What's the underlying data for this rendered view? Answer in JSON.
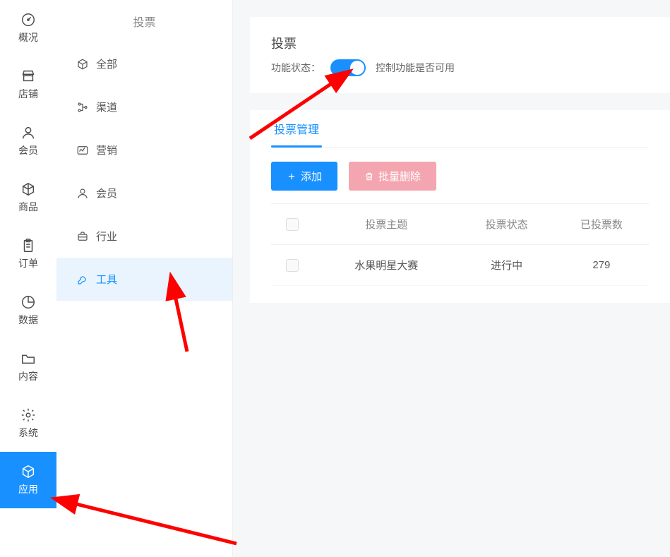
{
  "sidebarPrimary": {
    "items": [
      {
        "label": "概况",
        "active": false
      },
      {
        "label": "店铺",
        "active": false
      },
      {
        "label": "会员",
        "active": false
      },
      {
        "label": "商品",
        "active": false
      },
      {
        "label": "订单",
        "active": false
      },
      {
        "label": "数据",
        "active": false
      },
      {
        "label": "内容",
        "active": false
      },
      {
        "label": "系统",
        "active": false
      },
      {
        "label": "应用",
        "active": true
      }
    ]
  },
  "sidebarSecondary": {
    "title": "投票",
    "items": [
      {
        "label": "全部",
        "active": false
      },
      {
        "label": "渠道",
        "active": false
      },
      {
        "label": "营销",
        "active": false
      },
      {
        "label": "会员",
        "active": false
      },
      {
        "label": "行业",
        "active": false
      },
      {
        "label": "工具",
        "active": true
      }
    ]
  },
  "feature": {
    "title": "投票",
    "status_label": "功能状态：",
    "hint": "控制功能是否可用",
    "enabled": true
  },
  "manage": {
    "tabs": [
      {
        "label": "投票管理",
        "active": true
      }
    ],
    "buttons": {
      "add": "添加",
      "bulk_delete": "批量删除"
    },
    "columns": {
      "subject": "投票主题",
      "status": "投票状态",
      "count": "已投票数"
    },
    "rows": [
      {
        "subject": "水果明星大赛",
        "status": "进行中",
        "count": "279"
      }
    ]
  },
  "colors": {
    "primary": "#1890ff",
    "danger_light": "#f4a6b0",
    "annotation": "#ff0000"
  }
}
